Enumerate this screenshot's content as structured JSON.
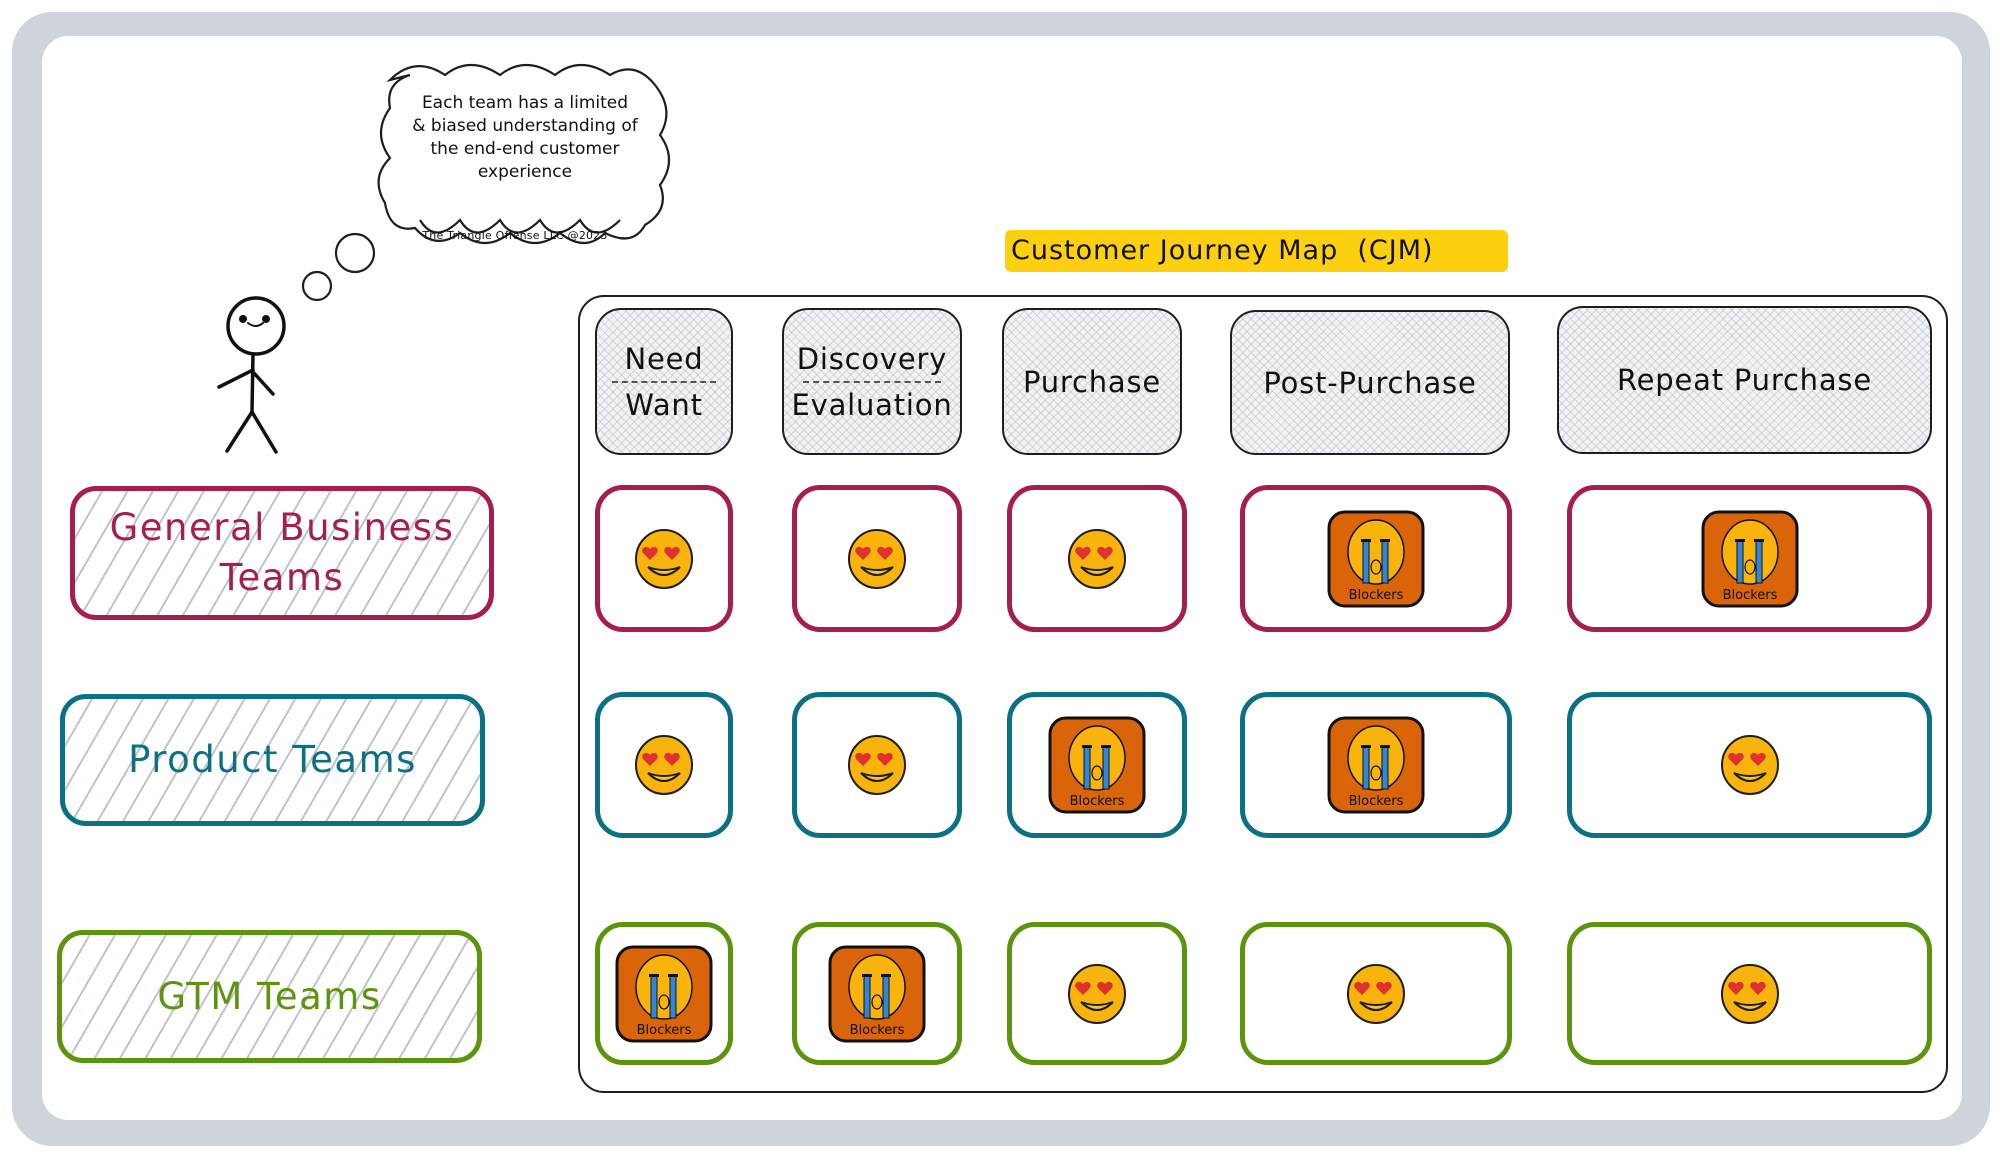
{
  "thought_bubble": {
    "text": "Each team has a limited & biased understanding of the end-end customer experience",
    "lines": [
      "Each team has a limited",
      "& biased understanding of",
      "the end-end customer",
      "experience"
    ],
    "credit": "The Triangle Offense LLC @2023"
  },
  "title": "Customer Journey Map  (CJM)",
  "stages": [
    {
      "lines": [
        "Need",
        "Want"
      ],
      "divided": true
    },
    {
      "lines": [
        "Discovery",
        "Evaluation"
      ],
      "divided": true
    },
    {
      "lines": [
        "Purchase"
      ],
      "divided": false
    },
    {
      "lines": [
        "Post-Purchase"
      ],
      "divided": false
    },
    {
      "lines": [
        "Repeat Purchase"
      ],
      "divided": false
    }
  ],
  "teams": [
    {
      "id": "gb",
      "label_lines": [
        "General Business",
        "Teams"
      ],
      "color": "#a61e4d",
      "cells": [
        "love",
        "love",
        "love",
        "blockers",
        "blockers"
      ]
    },
    {
      "id": "pr",
      "label_lines": [
        "Product Teams"
      ],
      "color": "#0c7085",
      "cells": [
        "love",
        "love",
        "blockers",
        "blockers",
        "love"
      ]
    },
    {
      "id": "gtm",
      "label_lines": [
        "GTM Teams"
      ],
      "color": "#5c940d",
      "cells": [
        "blockers",
        "blockers",
        "love",
        "love",
        "love"
      ]
    }
  ],
  "icons": {
    "love": "heart-eyes-emoji-icon",
    "blockers": "crying-face-blockers-icon",
    "blockers_label": "Blockers"
  },
  "colors": {
    "title_highlight": "#fcd00f",
    "frame": "#ced4da",
    "emoji_face": "#f8b40c",
    "heart": "#e03131",
    "blocker_bg": "#d9640a",
    "tears": "#2e86de"
  }
}
